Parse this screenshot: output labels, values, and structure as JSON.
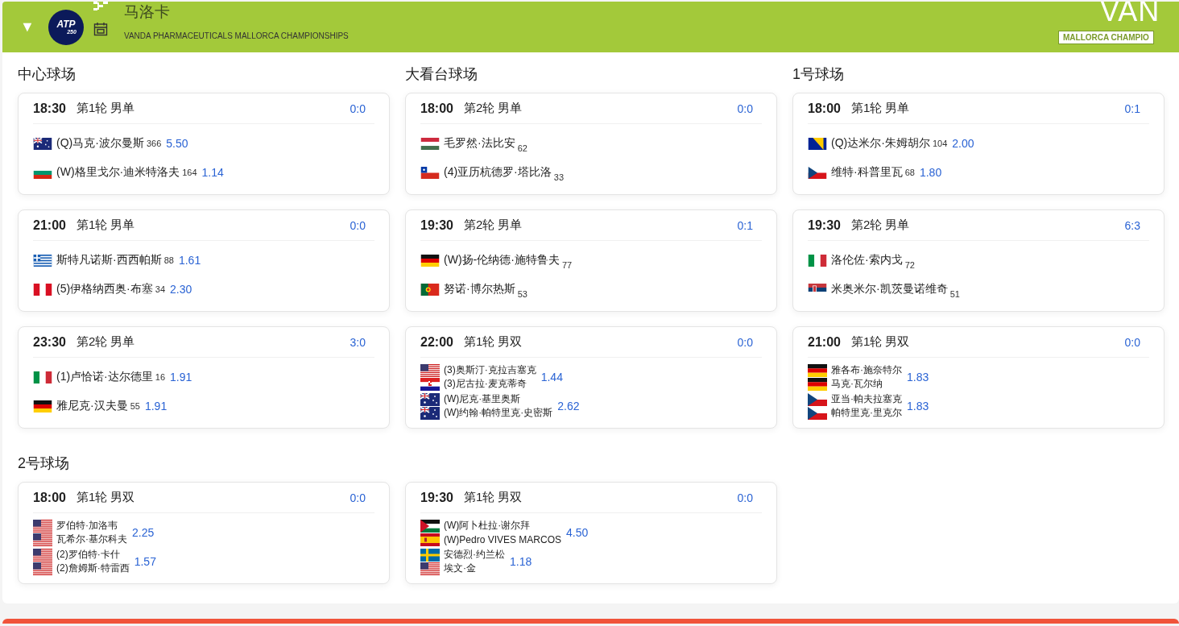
{
  "header": {
    "expand_glyph": "▼",
    "badge": "ATP",
    "badge_sub": "250",
    "title": "马洛卡",
    "subtitle": "VANDA PHARMACEUTICALS MALLORCA CHAMPIONSHIPS",
    "logo_text": "VAN",
    "logo_tagline": "MALLORCA CHAMPIO"
  },
  "courts": [
    {
      "name": "中心球场",
      "kind": "column",
      "matches": [
        {
          "time": "18:30",
          "round": "第1轮 男单",
          "score": "0:0",
          "teams": [
            {
              "players": [
                {
                  "kind": "au",
                  "name": "(Q)马克·波尔曼斯",
                  "rank": "366"
                }
              ],
              "odds": "5.50"
            },
            {
              "players": [
                {
                  "kind": "bg",
                  "name": "(W)格里戈尔·迪米特洛夫",
                  "rank": "164"
                }
              ],
              "odds": "1.14"
            }
          ]
        },
        {
          "time": "21:00",
          "round": "第1轮 男单",
          "score": "0:0",
          "teams": [
            {
              "players": [
                {
                  "kind": "gr",
                  "name": "斯特凡诺斯·西西帕斯",
                  "rank": "88"
                }
              ],
              "odds": "1.61"
            },
            {
              "players": [
                {
                  "kind": "pe",
                  "name": "(5)伊格纳西奥·布塞",
                  "rank": "34"
                }
              ],
              "odds": "2.30"
            }
          ]
        },
        {
          "time": "23:30",
          "round": "第2轮 男单",
          "score": "3:0",
          "teams": [
            {
              "players": [
                {
                  "kind": "it",
                  "name": "(1)卢恰诺·达尔德里",
                  "rank": "16"
                }
              ],
              "odds": "1.91"
            },
            {
              "players": [
                {
                  "kind": "de",
                  "name": "雅尼克·汉夫曼",
                  "rank": "55"
                }
              ],
              "odds": "1.91"
            }
          ]
        }
      ]
    },
    {
      "name": "大看台球场",
      "kind": "column",
      "matches": [
        {
          "time": "18:00",
          "round": "第2轮 男单",
          "score": "0:0",
          "teams": [
            {
              "players": [
                {
                  "kind": "hu",
                  "name": "毛罗然·法比安",
                  "rank": "62"
                }
              ]
            },
            {
              "players": [
                {
                  "kind": "cl",
                  "name": "(4)亚历杭德罗·塔比洛",
                  "rank": "33"
                }
              ]
            }
          ]
        },
        {
          "time": "19:30",
          "round": "第2轮 男单",
          "score": "0:1",
          "teams": [
            {
              "players": [
                {
                  "kind": "de",
                  "name": "(W)扬-伦纳德·施特鲁夫",
                  "rank": "77"
                }
              ]
            },
            {
              "players": [
                {
                  "kind": "pt",
                  "name": "努诺·博尔热斯",
                  "rank": "53"
                }
              ]
            }
          ]
        },
        {
          "time": "22:00",
          "round": "第1轮 男双",
          "score": "0:0",
          "teams": [
            {
              "players": [
                {
                  "kind": "us",
                  "name": "(3)奥斯汀·克拉吉塞克"
                },
                {
                  "kind": "hr",
                  "name": "(3)尼古拉·麦克蒂奇"
                }
              ],
              "odds": "1.44"
            },
            {
              "players": [
                {
                  "kind": "au",
                  "name": "(W)尼克·基里奥斯"
                },
                {
                  "kind": "au",
                  "name": "(W)约翰·帕特里克·史密斯"
                }
              ],
              "odds": "2.62"
            }
          ]
        }
      ]
    },
    {
      "name": "1号球场",
      "kind": "column",
      "matches": [
        {
          "time": "18:00",
          "round": "第1轮 男单",
          "score": "0:1",
          "teams": [
            {
              "players": [
                {
                  "kind": "ba",
                  "name": "(Q)达米尔·朱姆胡尔",
                  "rank": "104"
                }
              ],
              "odds": "2.00"
            },
            {
              "players": [
                {
                  "kind": "cz",
                  "name": "维特·科普里瓦",
                  "rank": "68"
                }
              ],
              "odds": "1.80"
            }
          ]
        },
        {
          "time": "19:30",
          "round": "第2轮 男单",
          "score": "6:3",
          "teams": [
            {
              "players": [
                {
                  "kind": "it",
                  "name": "洛伦佐·索内戈",
                  "rank": "72"
                }
              ]
            },
            {
              "players": [
                {
                  "kind": "rs",
                  "name": "米奥米尔·凯茨曼诺维奇",
                  "rank": "51"
                }
              ]
            }
          ]
        },
        {
          "time": "21:00",
          "round": "第1轮 男双",
          "score": "0:0",
          "teams": [
            {
              "players": [
                {
                  "kind": "de",
                  "name": "雅各布·施奈特尔"
                },
                {
                  "kind": "de",
                  "name": "马克·瓦尔纳"
                }
              ],
              "odds": "1.83"
            },
            {
              "players": [
                {
                  "kind": "cz",
                  "name": "亚当·帕夫拉塞克"
                },
                {
                  "kind": "cz",
                  "name": "帕特里克·里克尔"
                }
              ],
              "odds": "1.83"
            }
          ]
        }
      ]
    },
    {
      "name": "2号球场",
      "kind": "row",
      "matches": [
        {
          "time": "18:00",
          "round": "第1轮 男双",
          "score": "0:0",
          "teams": [
            {
              "players": [
                {
                  "kind": "us",
                  "name": "罗伯特·加洛韦"
                },
                {
                  "kind": "us",
                  "name": "瓦希尔·基尔科夫"
                }
              ],
              "odds": "2.25"
            },
            {
              "players": [
                {
                  "kind": "us",
                  "name": "(2)罗伯特·卡什"
                },
                {
                  "kind": "us",
                  "name": "(2)詹姆斯·特雷西"
                }
              ],
              "odds": "1.57"
            }
          ]
        },
        {
          "time": "19:30",
          "round": "第1轮 男双",
          "score": "0:0",
          "teams": [
            {
              "players": [
                {
                  "kind": "jo",
                  "name": "(W)阿卜杜拉·谢尔拜"
                },
                {
                  "kind": "es",
                  "name": "(W)Pedro VIVES MARCOS"
                }
              ],
              "odds": "4.50"
            },
            {
              "players": [
                {
                  "kind": "se",
                  "name": "安德烈·约兰松"
                },
                {
                  "kind": "us",
                  "name": "埃文·金"
                }
              ],
              "odds": "1.18"
            }
          ]
        }
      ]
    }
  ]
}
